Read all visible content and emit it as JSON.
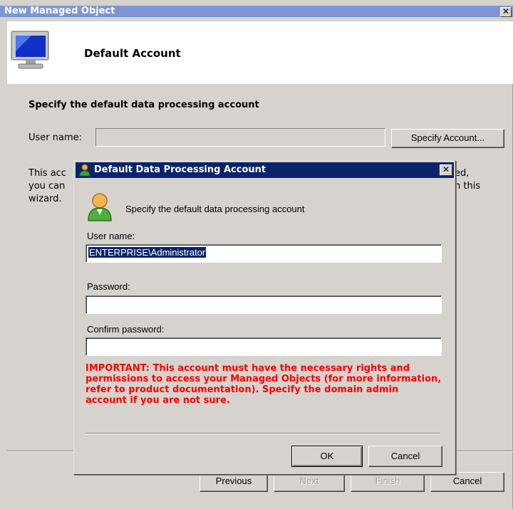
{
  "window": {
    "title": "New Managed Object",
    "close_glyph": "✕"
  },
  "header": {
    "title": "Default Account",
    "icon": "monitor-icon"
  },
  "content": {
    "heading": "Specify the default data processing account",
    "username_label": "User name:",
    "username_value": "",
    "specify_button": "Specify Account...",
    "info_left_1": "This acc",
    "info_left_2": "you can",
    "info_left_3": "wizard.",
    "info_right_1": "ed,",
    "info_right_2": "n this"
  },
  "footer": {
    "previous": "Previous",
    "next": "Next",
    "finish": "Finish",
    "cancel": "Cancel"
  },
  "dialog": {
    "title": "Default Data Processing Account",
    "close_glyph": "✕",
    "header_text": "Specify the default data processing account",
    "username_label": "User name:",
    "username_value": "ENTERPRISE\\Administrator",
    "password_label": "Password:",
    "password_value": "",
    "confirm_label": "Confirm password:",
    "confirm_value": "",
    "warning": "IMPORTANT: This account must have the necessary rights and permissions to access your Managed Objects (for more information, refer to product documentation). Specify the domain admin account if you are not sure.",
    "ok": "OK",
    "cancel": "Cancel",
    "icons": [
      "user-icon"
    ]
  },
  "colors": {
    "dialog_titlebar": "#0a246a",
    "window_titlebar": "#7b96d2",
    "face": "#d6d3ce",
    "warning": "#ff0000"
  }
}
